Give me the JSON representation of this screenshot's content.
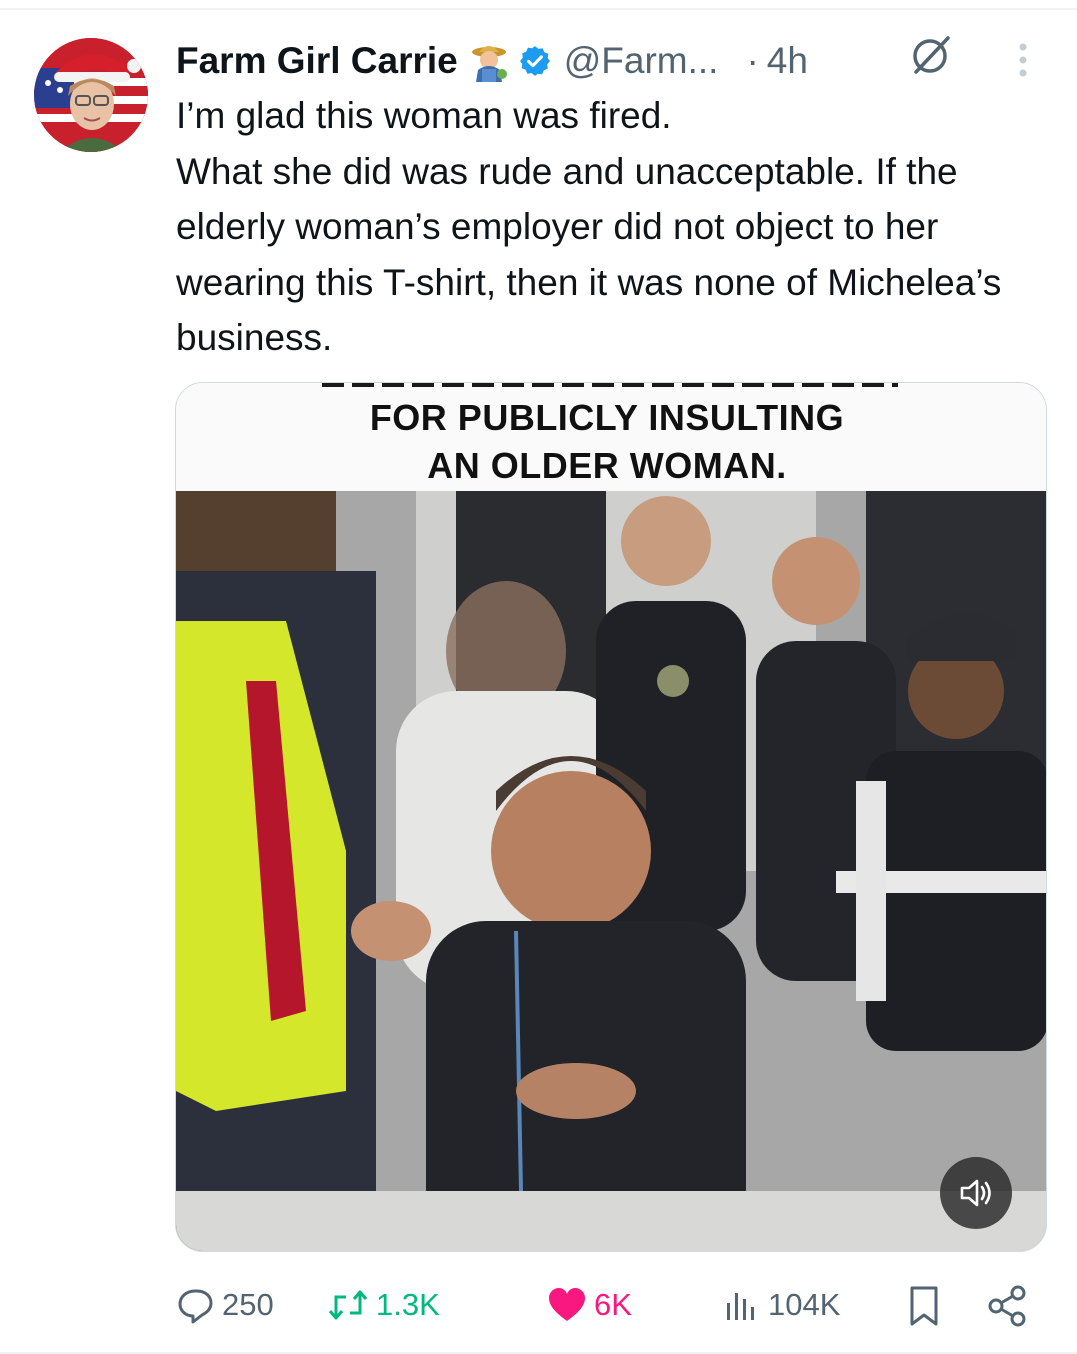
{
  "tweet": {
    "display_name": "Farm Girl Carrie",
    "name_emoji": "farmer-emoji",
    "verified": true,
    "handle": "@Farm...",
    "separator": "·",
    "time": "4h",
    "text_lines": [
      "I’m glad this woman was fired.",
      "What she did was rude and unacceptable. If the elderly woman’s employer did not object to her wearing this T-shirt, then it was none of Michelea’s business."
    ]
  },
  "media": {
    "caption_line1": "FOR PUBLICLY INSULTING",
    "caption_line2": "AN OLDER WOMAN.",
    "type": "video",
    "sound_icon": "speaker-icon"
  },
  "actions": {
    "replies": "250",
    "reposts": "1.3K",
    "likes": "6K",
    "views": "104K"
  },
  "colors": {
    "text": "#0f1419",
    "muted": "#536471",
    "verified": "#1d9bf0",
    "repost": "#00ba7c",
    "like": "#f91880"
  }
}
